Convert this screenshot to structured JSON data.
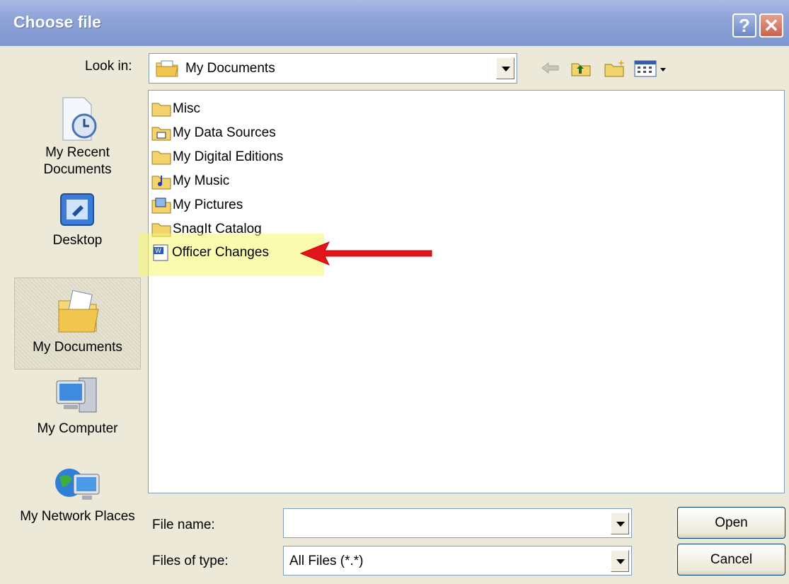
{
  "window": {
    "title": "Choose file",
    "help_symbol": "?",
    "close_symbol": "✕"
  },
  "lookin": {
    "label": "Look in:",
    "value": "My Documents"
  },
  "places": [
    {
      "label": "My Recent Documents",
      "icon": "recent-documents-icon"
    },
    {
      "label": "Desktop",
      "icon": "desktop-icon"
    },
    {
      "label": "My Documents",
      "icon": "my-documents-icon",
      "selected": true
    },
    {
      "label": "My Computer",
      "icon": "my-computer-icon"
    },
    {
      "label": "My Network Places",
      "icon": "network-places-icon"
    }
  ],
  "files": [
    {
      "name": "Misc",
      "icon": "folder-icon"
    },
    {
      "name": "My Data Sources",
      "icon": "data-sources-folder-icon"
    },
    {
      "name": "My Digital Editions",
      "icon": "folder-icon"
    },
    {
      "name": "My Music",
      "icon": "music-folder-icon"
    },
    {
      "name": "My Pictures",
      "icon": "pictures-folder-icon"
    },
    {
      "name": "SnagIt Catalog",
      "icon": "folder-icon"
    },
    {
      "name": "Officer Changes",
      "icon": "word-document-icon"
    }
  ],
  "file_name": {
    "label": "File name:",
    "value": ""
  },
  "file_type": {
    "label": "Files of type:",
    "value": "All Files (*.*)"
  },
  "buttons": {
    "open": "Open",
    "cancel": "Cancel"
  },
  "colors": {
    "titlebar": "#8ea3d8",
    "highlight": "#f8f86e",
    "arrow": "#e0161a"
  }
}
